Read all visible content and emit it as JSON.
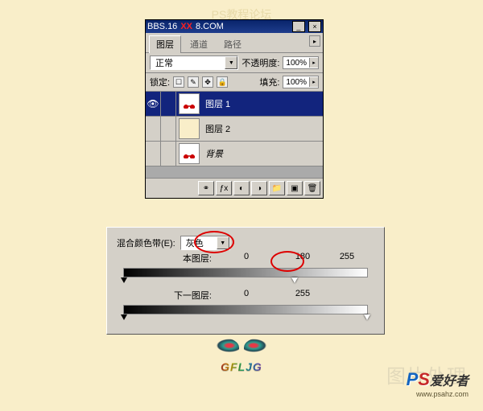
{
  "page_watermark": "PS教程论坛",
  "titlebar": {
    "site1": "BBS.16",
    "site2": "XX",
    "site3": "8.COM"
  },
  "tabs": {
    "layers": "图层",
    "channels": "通道",
    "paths": "路径"
  },
  "blend_mode": {
    "label": "正常",
    "opacity_label": "不透明度:",
    "opacity_value": "100%"
  },
  "lock": {
    "label": "锁定:",
    "fill_label": "填充:",
    "fill_value": "100%"
  },
  "layers": {
    "layer1": "图层 1",
    "layer2": "图层 2",
    "background": "背景"
  },
  "blend_panel": {
    "band_label": "混合颜色带(E):",
    "band_value": "灰色",
    "this_layer_label": "本图层:",
    "this_layer_low": "0",
    "this_layer_high": "180",
    "this_layer_max": "255",
    "next_layer_label": "下一图层:",
    "next_layer_low": "0",
    "next_layer_high": "255"
  },
  "logo_text": "GFLJG",
  "ps_logo": {
    "p": "P",
    "s": "S",
    "cn": "爱好者"
  },
  "ps_url": "www.psahz.com",
  "side_watermark": "图片处理"
}
